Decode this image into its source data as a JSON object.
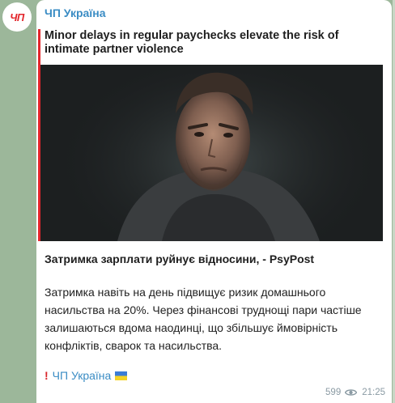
{
  "channel": {
    "name": "ЧП Україна",
    "avatar_text": "ЧП",
    "accent_color": "#e3262c",
    "link_color": "#3a8cc4"
  },
  "preview": {
    "headline": "Minor delays in regular paycheckss elevate the risk of intimate partner violence",
    "image_icon": "photo-man-hoodie"
  },
  "post": {
    "title": "Затримка зарплати руйнує відносини, - PsyPost",
    "body": "Затримка навіть на день підвищує ризик домашнього насильства на 20%. Через фінансові труднощі пари частіше залишаються вдома наодинці, що збільшує ймовірність конфліктів, сварок та насильства.",
    "signature_icon": "exclamation-icon",
    "signature": "ЧП Україна",
    "flag_icon": "ukraine-flag-icon"
  },
  "meta": {
    "views": "599",
    "view_icon": "eye-icon",
    "time": "21:25"
  }
}
